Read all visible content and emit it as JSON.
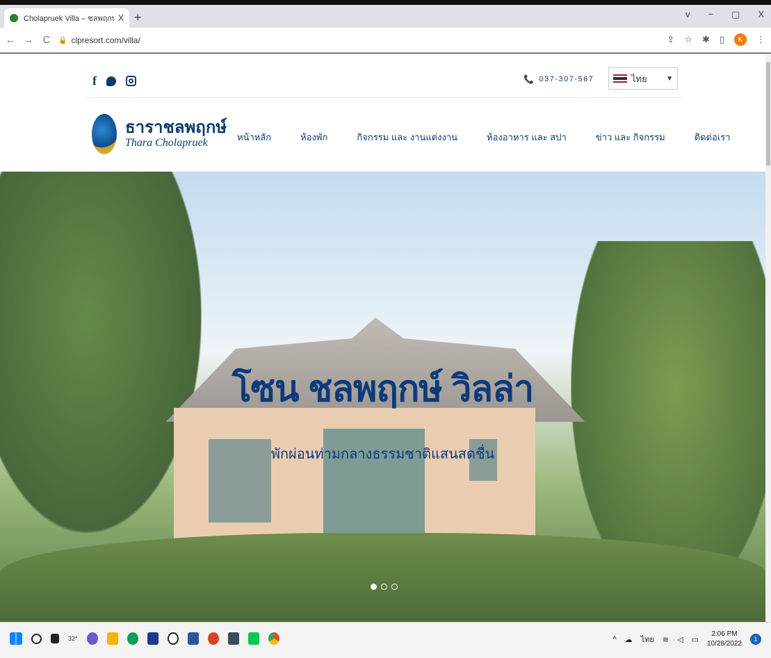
{
  "browser": {
    "tab_title": "Cholapruek Villa – ชลพฤกษ์วิลล่า",
    "tab_close": "X",
    "new_tab": "+",
    "url": "clpresort.com/villa/",
    "window_controls": [
      "v",
      "−",
      "▢",
      "X"
    ],
    "profile_initial": "K"
  },
  "site": {
    "social_icons": [
      "facebook-icon",
      "line-icon",
      "instagram-icon"
    ],
    "phone": "037-307-567",
    "language": {
      "selected": "ไทย"
    },
    "logo": {
      "thai": "ธาราชลพฤกษ์",
      "english": "Thara Cholapruek"
    },
    "nav": [
      "หน้าหลัก",
      "ห้องพัก",
      "กิจกรรม และ งานแต่งงาน",
      "ห้องอาหาร และ สปา",
      "ข่าว และ กิจกรรม",
      "ติดต่อเรา"
    ]
  },
  "hero": {
    "title": "โซน ชลพฤกษ์ วิลล่า",
    "subtitle": "พักผ่อนท่ามกลางธรรมชาติแสนสดชื่น",
    "slides_total": 3,
    "active_slide": 1
  },
  "taskbar": {
    "weather": "32°",
    "tray_lang": "ไทย",
    "time": "2:06 PM",
    "date": "10/28/2022",
    "notifications": "1"
  },
  "colors": {
    "brand_navy": "#0e3a6b",
    "hero_text": "#0c3a7a"
  }
}
